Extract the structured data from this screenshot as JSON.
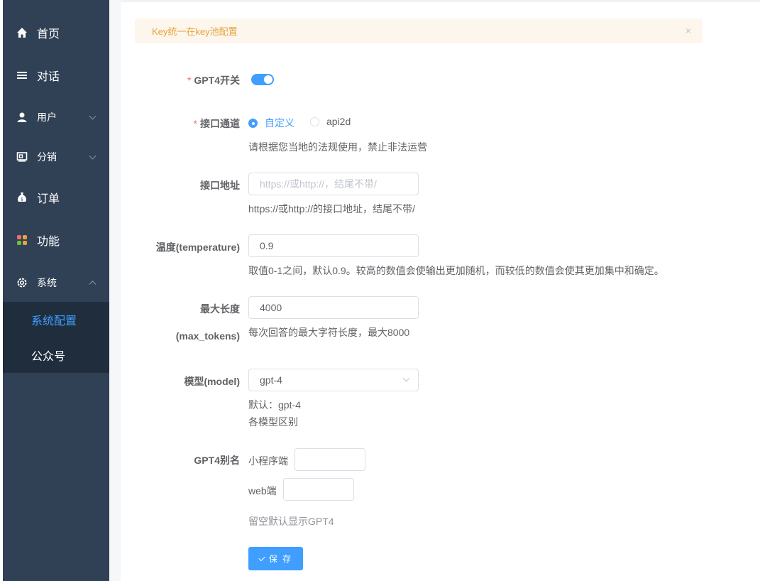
{
  "sidebar": {
    "items": [
      {
        "label": "首页",
        "icon": "home-icon"
      },
      {
        "label": "对话",
        "icon": "list-icon"
      },
      {
        "label": "用户",
        "icon": "user-icon"
      },
      {
        "label": "分销",
        "icon": "distribution-icon"
      },
      {
        "label": "订单",
        "icon": "money-bag-icon"
      },
      {
        "label": "功能",
        "icon": "grid-icon"
      },
      {
        "label": "系统",
        "icon": "gear-icon"
      }
    ],
    "submenu": [
      {
        "label": "系统配置",
        "active": true
      },
      {
        "label": "公众号",
        "active": false
      }
    ]
  },
  "alert": {
    "text": "Key统一在key池配置",
    "close": "×"
  },
  "form": {
    "gpt4_switch": {
      "label": "GPT4开关",
      "required": "*",
      "on": true
    },
    "channel": {
      "label": "接口通道",
      "required": "*",
      "options": [
        "自定义",
        "api2d"
      ],
      "selected": "自定义",
      "hint": "请根据您当地的法规使用，禁止非法运营"
    },
    "api_url": {
      "label": "接口地址",
      "value": "",
      "placeholder": "https://或http://，结尾不带/",
      "hint": "https://或http://的接口地址，结尾不带/"
    },
    "temperature": {
      "label": "温度(temperature)",
      "value": "0.9",
      "hint": "取值0-1之间，默认0.9。较高的数值会使输出更加随机，而较低的数值会使其更加集中和确定。"
    },
    "max_tokens": {
      "label": "最大长度",
      "label2": "(max_tokens)",
      "value": "4000",
      "hint": "每次回答的最大字符长度，最大8000"
    },
    "model": {
      "label": "模型(model)",
      "value": "gpt-4",
      "hint1": "默认：gpt-4",
      "hint2": "各模型区别"
    },
    "alias": {
      "label": "GPT4别名",
      "miniprogram_label": "小程序端",
      "miniprogram_value": "",
      "web_label": "web端",
      "web_value": "",
      "hint": "留空默认显示GPT4"
    },
    "save_label": "保 存"
  },
  "colors": {
    "primary": "#409eff",
    "sidebar": "#304156",
    "warning": "#e6a23c",
    "required": "#f56c6c"
  }
}
